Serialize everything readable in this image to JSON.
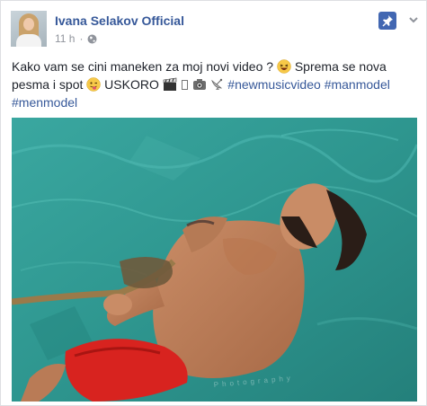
{
  "page": {
    "name": "Ivana Selakov Official",
    "time": "11 h",
    "separator": "·"
  },
  "icons": {
    "avatar": "profile-photo",
    "privacy": "globe-icon",
    "pin": "pin-icon",
    "menu": "chevron-down-icon"
  },
  "post": {
    "text_part1": "Kako vam se cini maneken za moj novi video ?",
    "text_part2": "Sprema se nova pesma i spot",
    "text_part3": "USKORO",
    "hashtags": [
      "#newmusicvideo",
      "#manmodel",
      "#menmodel"
    ],
    "photo_watermark": "Photography"
  },
  "colors": {
    "link": "#365899",
    "meta": "#90949c",
    "pin_bg": "#4267b2",
    "water": "#2f9a92"
  }
}
